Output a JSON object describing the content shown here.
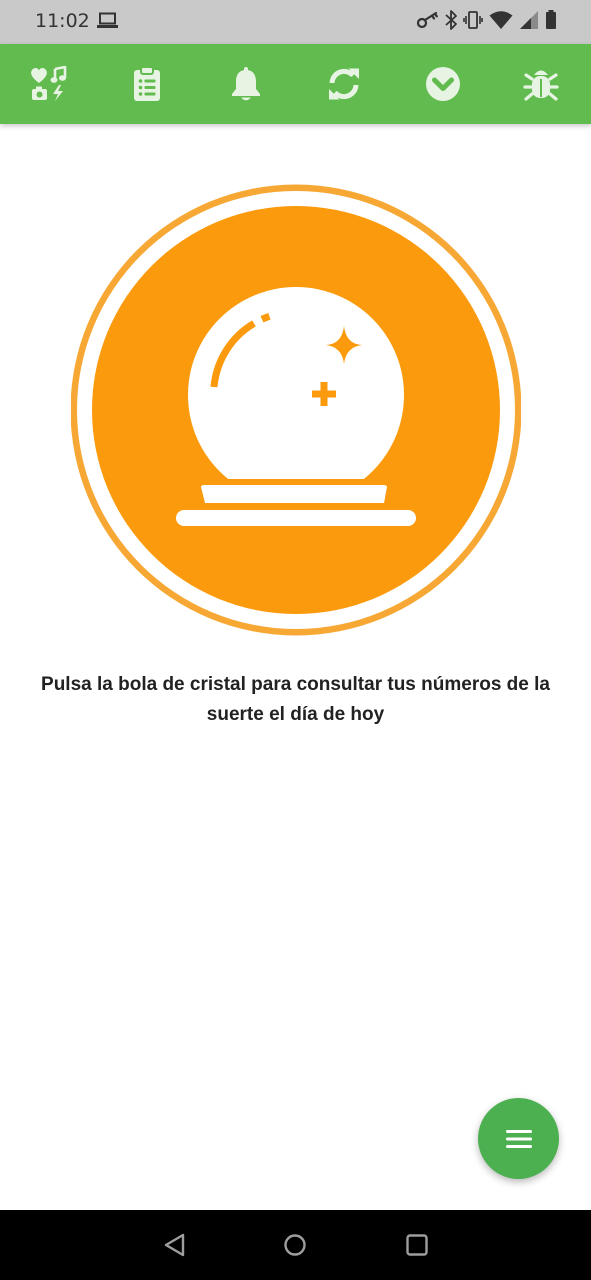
{
  "colors": {
    "status_bar_bg": "#c9c9c9",
    "toolbar_bg": "#62bb4f",
    "toolbar_icon": "#e7f4e3",
    "orb_orange": "#fb9a0c",
    "orb_ring": "#f7a834",
    "fab_bg": "#4caf50",
    "nav_bar_bg": "#000000"
  },
  "status_bar": {
    "time": "11:02",
    "icons": [
      "laptop-icon",
      "key-icon",
      "bluetooth-icon",
      "vibrate-icon",
      "wifi-icon",
      "signal-icon",
      "battery-icon"
    ]
  },
  "toolbar": {
    "items": [
      {
        "name": "hobbies",
        "icon": "heart-music-camera-bolt-icon"
      },
      {
        "name": "clipboard",
        "icon": "clipboard-list-icon"
      },
      {
        "name": "notifications",
        "icon": "bell-icon"
      },
      {
        "name": "refresh",
        "icon": "sync-icon"
      },
      {
        "name": "expand",
        "icon": "chevron-circle-down-icon"
      },
      {
        "name": "debug",
        "icon": "bug-icon"
      }
    ]
  },
  "main": {
    "orb_icon": "crystal-ball-icon",
    "prompt": "Pulsa la bola de cristal para consultar tus números de la suerte el día de hoy"
  },
  "fab": {
    "icon": "menu-icon"
  },
  "nav_bar": {
    "buttons": [
      "back-icon",
      "home-icon",
      "recents-icon"
    ]
  }
}
